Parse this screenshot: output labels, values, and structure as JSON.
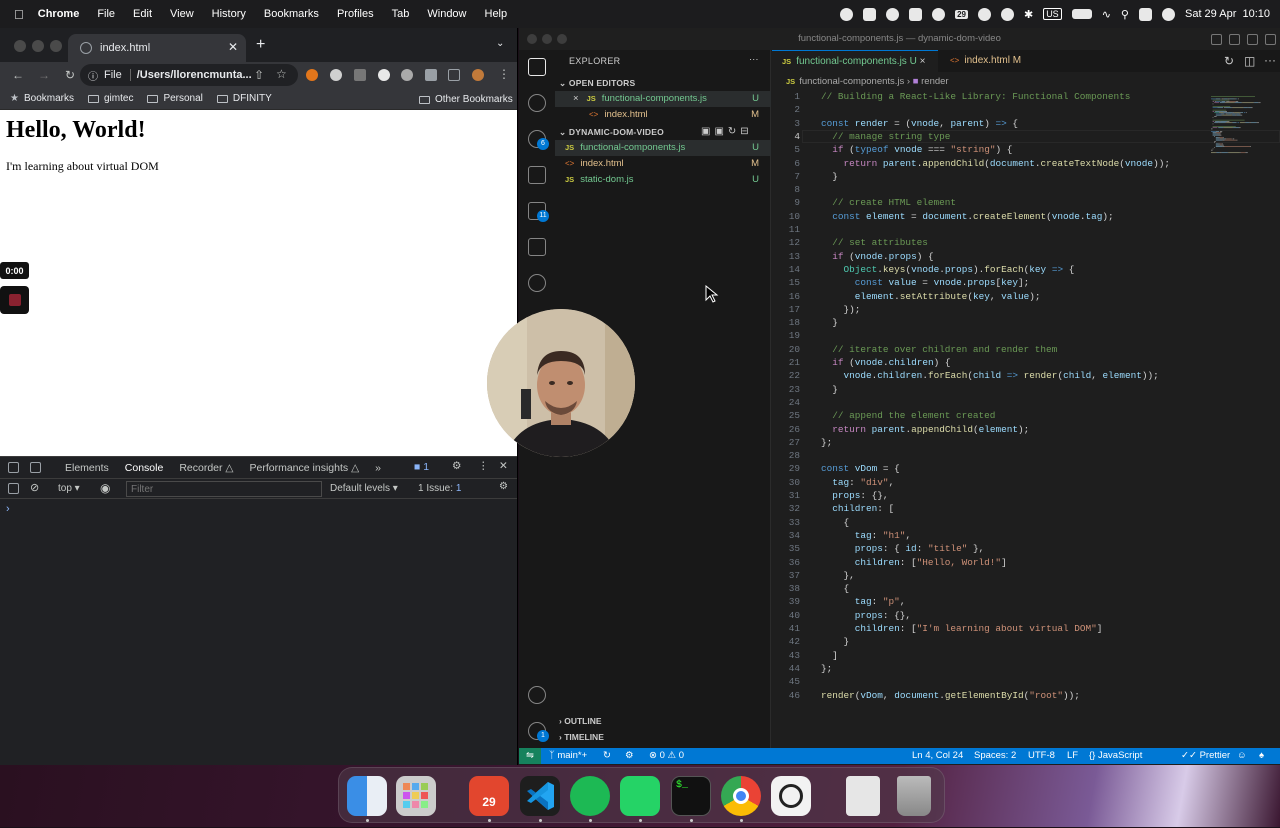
{
  "menubar": {
    "app": "Chrome",
    "items": [
      "File",
      "Edit",
      "View",
      "History",
      "Bookmarks",
      "Profiles",
      "Tab",
      "Window",
      "Help"
    ],
    "input_source": "US",
    "datetime": "Sat 29 Apr  10:10",
    "calendar_badge": "29"
  },
  "chrome": {
    "tab_title": "index.html",
    "address_scheme": "File",
    "address_path": "/Users/llorencmunta...",
    "bookmarks": [
      "Bookmarks",
      "gimtec",
      "Personal",
      "DFINITY"
    ],
    "other_bookmarks": "Other Bookmarks",
    "page": {
      "heading": "Hello, World!",
      "paragraph": "I'm learning about virtual DOM"
    },
    "recorder_time": "0:00",
    "devtools": {
      "tabs": [
        "Elements",
        "Console",
        "Recorder",
        "Performance insights"
      ],
      "recorder_beta_icon": "flask-icon",
      "issues_count": "1",
      "context": "top",
      "filter_placeholder": "Filter",
      "levels": "Default levels",
      "issue_label": "1 Issue:",
      "issue_count": "1",
      "prompt": "›"
    }
  },
  "vscode": {
    "window_title": "functional-components.js — dynamic-dom-video",
    "explorer_title": "EXPLORER",
    "open_editors_label": "OPEN EDITORS",
    "open_editors": [
      {
        "name": "functional-components.js",
        "type": "JS",
        "status": "U",
        "close": "×"
      },
      {
        "name": "index.html",
        "type": "<>",
        "status": "M"
      }
    ],
    "folder_label": "DYNAMIC-DOM-VIDEO",
    "files": [
      {
        "name": "functional-components.js",
        "type": "JS",
        "status": "U"
      },
      {
        "name": "index.html",
        "type": "<>",
        "status": "M"
      },
      {
        "name": "static-dom.js",
        "type": "JS",
        "status": "U"
      }
    ],
    "outline_label": "OUTLINE",
    "timeline_label": "TIMELINE",
    "badges": {
      "scm": "6",
      "extensions": "11",
      "accounts": "1"
    },
    "tabs": [
      {
        "name": "functional-components.js",
        "status": "U",
        "close": "×"
      },
      {
        "name": "index.html",
        "status": "M"
      }
    ],
    "breadcrumb": {
      "file": "functional-components.js",
      "symbol": "render"
    },
    "status": {
      "branch": "main*+",
      "problems": "0",
      "warnings": "0",
      "position": "Ln 4, Col 24",
      "spaces": "Spaces: 2",
      "encoding": "UTF-8",
      "eol": "LF",
      "language": "JavaScript",
      "formatter": "Prettier"
    },
    "current_line": 4,
    "code": [
      [
        [
          "c",
          "// Building a React-Like Library: Functional Components"
        ]
      ],
      [],
      [
        [
          "k",
          "const "
        ],
        [
          "v",
          "render"
        ],
        [
          "p",
          " = ("
        ],
        [
          "v",
          "vnode"
        ],
        [
          "p",
          ", "
        ],
        [
          "v",
          "parent"
        ],
        [
          "p",
          ") "
        ],
        [
          "k",
          "=>"
        ],
        [
          "p",
          " {"
        ]
      ],
      [
        [
          "c",
          "  // manage string type"
        ]
      ],
      [
        [
          "p",
          "  "
        ],
        [
          "f",
          "if"
        ],
        [
          "p",
          " ("
        ],
        [
          "k",
          "typeof"
        ],
        [
          "p",
          " "
        ],
        [
          "v",
          "vnode"
        ],
        [
          "p",
          " === "
        ],
        [
          "s",
          "\"string\""
        ],
        [
          "p",
          ") {"
        ]
      ],
      [
        [
          "p",
          "    "
        ],
        [
          "f",
          "return"
        ],
        [
          "p",
          " "
        ],
        [
          "v",
          "parent"
        ],
        [
          "p",
          "."
        ],
        [
          "m",
          "appendChild"
        ],
        [
          "p",
          "("
        ],
        [
          "v",
          "document"
        ],
        [
          "p",
          "."
        ],
        [
          "m",
          "createTextNode"
        ],
        [
          "p",
          "("
        ],
        [
          "v",
          "vnode"
        ],
        [
          "p",
          "));"
        ]
      ],
      [
        [
          "p",
          "  }"
        ]
      ],
      [],
      [
        [
          "c",
          "  // create HTML element"
        ]
      ],
      [
        [
          "p",
          "  "
        ],
        [
          "k",
          "const "
        ],
        [
          "v",
          "element"
        ],
        [
          "p",
          " = "
        ],
        [
          "v",
          "document"
        ],
        [
          "p",
          "."
        ],
        [
          "m",
          "createElement"
        ],
        [
          "p",
          "("
        ],
        [
          "v",
          "vnode"
        ],
        [
          "p",
          "."
        ],
        [
          "v",
          "tag"
        ],
        [
          "p",
          ");"
        ]
      ],
      [],
      [
        [
          "c",
          "  // set attributes"
        ]
      ],
      [
        [
          "p",
          "  "
        ],
        [
          "f",
          "if"
        ],
        [
          "p",
          " ("
        ],
        [
          "v",
          "vnode"
        ],
        [
          "p",
          "."
        ],
        [
          "v",
          "props"
        ],
        [
          "p",
          ") {"
        ]
      ],
      [
        [
          "p",
          "    "
        ],
        [
          "t",
          "Object"
        ],
        [
          "p",
          "."
        ],
        [
          "m",
          "keys"
        ],
        [
          "p",
          "("
        ],
        [
          "v",
          "vnode"
        ],
        [
          "p",
          "."
        ],
        [
          "v",
          "props"
        ],
        [
          "p",
          ")."
        ],
        [
          "m",
          "forEach"
        ],
        [
          "p",
          "("
        ],
        [
          "v",
          "key"
        ],
        [
          "p",
          " "
        ],
        [
          "k",
          "=>"
        ],
        [
          "p",
          " {"
        ]
      ],
      [
        [
          "p",
          "      "
        ],
        [
          "k",
          "const "
        ],
        [
          "v",
          "value"
        ],
        [
          "p",
          " = "
        ],
        [
          "v",
          "vnode"
        ],
        [
          "p",
          "."
        ],
        [
          "v",
          "props"
        ],
        [
          "p",
          "["
        ],
        [
          "v",
          "key"
        ],
        [
          "p",
          "];"
        ]
      ],
      [
        [
          "p",
          "      "
        ],
        [
          "v",
          "element"
        ],
        [
          "p",
          "."
        ],
        [
          "m",
          "setAttribute"
        ],
        [
          "p",
          "("
        ],
        [
          "v",
          "key"
        ],
        [
          "p",
          ", "
        ],
        [
          "v",
          "value"
        ],
        [
          "p",
          ");"
        ]
      ],
      [
        [
          "p",
          "    });"
        ]
      ],
      [
        [
          "p",
          "  }"
        ]
      ],
      [],
      [
        [
          "c",
          "  // iterate over children and render them"
        ]
      ],
      [
        [
          "p",
          "  "
        ],
        [
          "f",
          "if"
        ],
        [
          "p",
          " ("
        ],
        [
          "v",
          "vnode"
        ],
        [
          "p",
          "."
        ],
        [
          "v",
          "children"
        ],
        [
          "p",
          ") {"
        ]
      ],
      [
        [
          "p",
          "    "
        ],
        [
          "v",
          "vnode"
        ],
        [
          "p",
          "."
        ],
        [
          "v",
          "children"
        ],
        [
          "p",
          "."
        ],
        [
          "m",
          "forEach"
        ],
        [
          "p",
          "("
        ],
        [
          "v",
          "child"
        ],
        [
          "p",
          " "
        ],
        [
          "k",
          "=>"
        ],
        [
          "p",
          " "
        ],
        [
          "m",
          "render"
        ],
        [
          "p",
          "("
        ],
        [
          "v",
          "child"
        ],
        [
          "p",
          ", "
        ],
        [
          "v",
          "element"
        ],
        [
          "p",
          "));"
        ]
      ],
      [
        [
          "p",
          "  }"
        ]
      ],
      [],
      [
        [
          "c",
          "  // append the element created"
        ]
      ],
      [
        [
          "p",
          "  "
        ],
        [
          "f",
          "return"
        ],
        [
          "p",
          " "
        ],
        [
          "v",
          "parent"
        ],
        [
          "p",
          "."
        ],
        [
          "m",
          "appendChild"
        ],
        [
          "p",
          "("
        ],
        [
          "v",
          "element"
        ],
        [
          "p",
          ");"
        ]
      ],
      [
        [
          "p",
          "};"
        ]
      ],
      [],
      [
        [
          "k",
          "const "
        ],
        [
          "v",
          "vDom"
        ],
        [
          "p",
          " = {"
        ]
      ],
      [
        [
          "p",
          "  "
        ],
        [
          "v",
          "tag"
        ],
        [
          "p",
          ": "
        ],
        [
          "s",
          "\"div\""
        ],
        [
          "p",
          ","
        ]
      ],
      [
        [
          "p",
          "  "
        ],
        [
          "v",
          "props"
        ],
        [
          "p",
          ": {},"
        ]
      ],
      [
        [
          "p",
          "  "
        ],
        [
          "v",
          "children"
        ],
        [
          "p",
          ": ["
        ]
      ],
      [
        [
          "p",
          "    {"
        ]
      ],
      [
        [
          "p",
          "      "
        ],
        [
          "v",
          "tag"
        ],
        [
          "p",
          ": "
        ],
        [
          "s",
          "\"h1\""
        ],
        [
          "p",
          ","
        ]
      ],
      [
        [
          "p",
          "      "
        ],
        [
          "v",
          "props"
        ],
        [
          "p",
          ": { "
        ],
        [
          "v",
          "id"
        ],
        [
          "p",
          ": "
        ],
        [
          "s",
          "\"title\""
        ],
        [
          "p",
          " },"
        ]
      ],
      [
        [
          "p",
          "      "
        ],
        [
          "v",
          "children"
        ],
        [
          "p",
          ": ["
        ],
        [
          "s",
          "\"Hello, World!\""
        ],
        [
          "p",
          "]"
        ]
      ],
      [
        [
          "p",
          "    },"
        ]
      ],
      [
        [
          "p",
          "    {"
        ]
      ],
      [
        [
          "p",
          "      "
        ],
        [
          "v",
          "tag"
        ],
        [
          "p",
          ": "
        ],
        [
          "s",
          "\"p\""
        ],
        [
          "p",
          ","
        ]
      ],
      [
        [
          "p",
          "      "
        ],
        [
          "v",
          "props"
        ],
        [
          "p",
          ": {},"
        ]
      ],
      [
        [
          "p",
          "      "
        ],
        [
          "v",
          "children"
        ],
        [
          "p",
          ": ["
        ],
        [
          "s",
          "\"I'm learning about virtual DOM\""
        ],
        [
          "p",
          "]"
        ]
      ],
      [
        [
          "p",
          "    }"
        ]
      ],
      [
        [
          "p",
          "  ]"
        ]
      ],
      [
        [
          "p",
          "};"
        ]
      ],
      [],
      [
        [
          "m",
          "render"
        ],
        [
          "p",
          "("
        ],
        [
          "v",
          "vDom"
        ],
        [
          "p",
          ", "
        ],
        [
          "v",
          "document"
        ],
        [
          "p",
          "."
        ],
        [
          "m",
          "getElementById"
        ],
        [
          "p",
          "("
        ],
        [
          "s",
          "\"root\""
        ],
        [
          "p",
          "));"
        ]
      ]
    ]
  },
  "dock": [
    "Finder",
    "Launchpad",
    "Fantastical",
    "Visual Studio Code",
    "Spotify",
    "WhatsApp",
    "Terminal",
    "Google Chrome",
    "OpenAI",
    "Preview",
    "Trash"
  ],
  "dock_calendar": "29",
  "colors": {
    "c": "#6a9955",
    "k": "#569cd6",
    "v": "#9cdcfe",
    "p": "#d4d4d4",
    "f": "#c586c0",
    "s": "#ce9178",
    "m": "#dcdcaa",
    "t": "#4ec9b0",
    "accent": "#0078d4"
  }
}
